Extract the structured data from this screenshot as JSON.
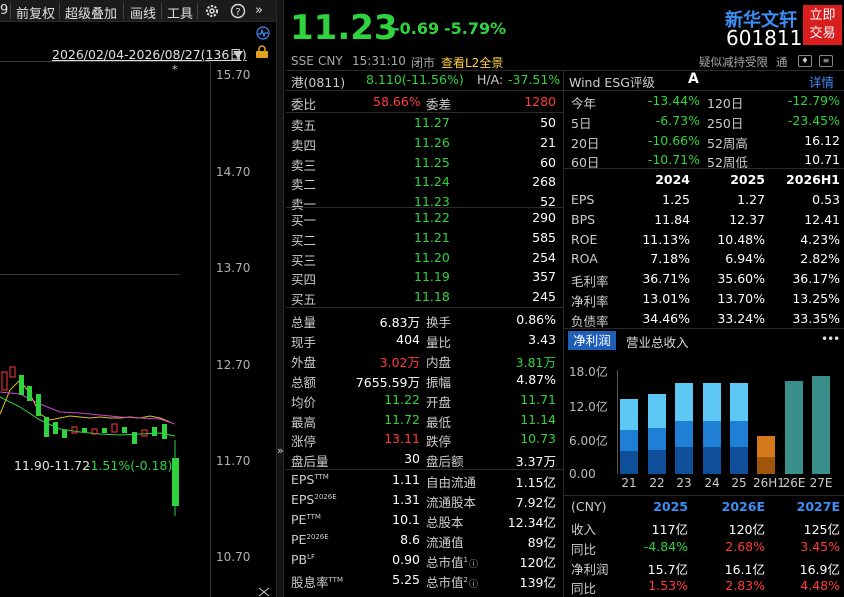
{
  "toolbar": {
    "items": [
      "前复权",
      "超级叠加",
      "画线",
      "工具"
    ],
    "cut_left": "9",
    "more": "»"
  },
  "chart": {
    "date_range": "2026/02/04-2026/08/27(136日)",
    "star": "*",
    "y_ticks": [
      "15.70",
      "14.70",
      "13.70",
      "12.70",
      "11.70",
      "10.70"
    ],
    "range_label": "11.90-11.72",
    "range_change": "-1.51%(-0.18)",
    "collapse_arrow": "»"
  },
  "quote": {
    "price": "11.23",
    "change": "-0.69",
    "change_pct": "-5.79%",
    "exchange": "SSE",
    "currency": "CNY",
    "time": "15:31:10",
    "status": "闭市",
    "l2_link": "查看L2全景",
    "name": "新华文轩",
    "code": "601811",
    "trade_btn_line1": "立即",
    "trade_btn_line2": "交易",
    "note": "疑似减持受限",
    "note2": "通"
  },
  "hk_row": {
    "label": "港(0811)",
    "value": "8.110(-11.56%)",
    "ha_label": "H/A:",
    "ha_value": "-37.51%"
  },
  "orderbook": {
    "wei_bi_label": "委比",
    "wei_bi": "58.66%",
    "wei_cha_label": "委差",
    "wei_cha": "1280",
    "sells": [
      {
        "label": "卖五",
        "price": "11.27",
        "vol": "50"
      },
      {
        "label": "卖四",
        "price": "11.26",
        "vol": "21"
      },
      {
        "label": "卖三",
        "price": "11.25",
        "vol": "60"
      },
      {
        "label": "卖二",
        "price": "11.24",
        "vol": "268"
      },
      {
        "label": "卖一",
        "price": "11.23",
        "vol": "52"
      }
    ],
    "buys": [
      {
        "label": "买一",
        "price": "11.22",
        "vol": "290"
      },
      {
        "label": "买二",
        "price": "11.21",
        "vol": "585"
      },
      {
        "label": "买三",
        "price": "11.20",
        "vol": "254"
      },
      {
        "label": "买四",
        "price": "11.19",
        "vol": "357"
      },
      {
        "label": "买五",
        "price": "11.18",
        "vol": "245"
      }
    ]
  },
  "stats": [
    {
      "l1": "总量",
      "v1": "6.83万",
      "c1": "white",
      "l2": "换手",
      "v2": "0.86%",
      "c2": "white"
    },
    {
      "l1": "现手",
      "v1": "404",
      "c1": "white",
      "l2": "量比",
      "v2": "3.43",
      "c2": "white"
    },
    {
      "l1": "外盘",
      "v1": "3.02万",
      "c1": "red",
      "l2": "内盘",
      "v2": "3.81万",
      "c2": "green"
    },
    {
      "l1": "总额",
      "v1": "7655.59万",
      "c1": "white",
      "l2": "振幅",
      "v2": "4.87%",
      "c2": "white"
    },
    {
      "l1": "均价",
      "v1": "11.22",
      "c1": "green",
      "l2": "开盘",
      "v2": "11.71",
      "c2": "green"
    },
    {
      "l1": "最高",
      "v1": "11.72",
      "c1": "green",
      "l2": "最低",
      "v2": "11.14",
      "c2": "green"
    },
    {
      "l1": "涨停",
      "v1": "13.11",
      "c1": "red",
      "l2": "跌停",
      "v2": "10.73",
      "c2": "green"
    },
    {
      "l1": "盘后量",
      "v1": "30",
      "c1": "white",
      "l2": "盘后额",
      "v2": "3.37万",
      "c2": "white"
    }
  ],
  "valuation": [
    {
      "l1": "EPS",
      "s1": "TTM",
      "v1": "1.11",
      "l2": "自由流通",
      "v2": "1.15亿"
    },
    {
      "l1": "EPS",
      "s1": "2026E",
      "v1": "1.31",
      "l2": "流通股本",
      "v2": "7.92亿"
    },
    {
      "l1": "PE",
      "s1": "TTM",
      "v1": "10.1",
      "l2": "总股本",
      "v2": "12.34亿"
    },
    {
      "l1": "PE",
      "s1": "2026E",
      "v1": "8.6",
      "l2": "流通值",
      "v2": "89亿"
    },
    {
      "l1": "PB",
      "s1": "LF",
      "v1": "0.90",
      "l2": "总市值",
      "s2": "1",
      "v2": "120亿"
    },
    {
      "l1": "股息率",
      "s1": "TTM",
      "v1": "5.25",
      "l2": "总市值",
      "s2": "2",
      "v2": "139亿"
    }
  ],
  "esg": {
    "label": "Wind ESG评级",
    "rating": "A",
    "detail": "详情"
  },
  "perf": [
    {
      "l1": "今年",
      "v1": "-13.44%",
      "l2": "120日",
      "v2": "-12.79%",
      "c2": "green"
    },
    {
      "l1": "5日",
      "v1": "-6.73%",
      "l2": "250日",
      "v2": "-23.45%",
      "c2": "green"
    },
    {
      "l1": "20日",
      "v1": "-10.66%",
      "l2": "52周高",
      "v2": "16.12",
      "c2": "white"
    },
    {
      "l1": "60日",
      "v1": "-10.71%",
      "l2": "52周低",
      "v2": "10.71",
      "c2": "white"
    }
  ],
  "fin": {
    "headers": [
      "2024",
      "2025",
      "2026H1"
    ],
    "rows": [
      {
        "label": "EPS",
        "vals": [
          "1.25",
          "1.27",
          "0.53"
        ]
      },
      {
        "label": "BPS",
        "vals": [
          "11.84",
          "12.37",
          "12.41"
        ]
      },
      {
        "label": "ROE",
        "vals": [
          "11.13%",
          "10.48%",
          "4.23%"
        ]
      },
      {
        "label": "ROA",
        "vals": [
          "7.18%",
          "6.94%",
          "2.82%"
        ]
      },
      {
        "label": "毛利率",
        "vals": [
          "36.71%",
          "35.60%",
          "36.17%"
        ]
      },
      {
        "label": "净利率",
        "vals": [
          "13.01%",
          "13.70%",
          "13.25%"
        ]
      },
      {
        "label": "负债率",
        "vals": [
          "34.46%",
          "33.24%",
          "33.35%"
        ]
      }
    ]
  },
  "profit_tabs": {
    "tab1": "净利润",
    "tab2": "营业总收入",
    "more": "•••"
  },
  "chart_data": {
    "type": "bar",
    "categories": [
      "21",
      "22",
      "23",
      "24",
      "25",
      "26H1",
      "26E",
      "27E"
    ],
    "y_ticks": [
      "18.0亿",
      "12.0亿",
      "6.00亿",
      "0.00"
    ],
    "ylim": [
      0,
      18
    ],
    "values": [
      13.0,
      13.8,
      15.8,
      15.7,
      15.7,
      6.5,
      16.1,
      16.9
    ]
  },
  "forecast": {
    "unit": "(CNY)",
    "headers": [
      "2025",
      "2026E",
      "2027E"
    ],
    "rows": [
      {
        "label": "收入",
        "vals": [
          "117亿",
          "120亿",
          "125亿"
        ],
        "colors": [
          "white",
          "white",
          "white"
        ]
      },
      {
        "label": "同比",
        "vals": [
          "-4.84%",
          "2.68%",
          "3.45%"
        ],
        "colors": [
          "green",
          "red",
          "red"
        ]
      },
      {
        "label": "净利润",
        "vals": [
          "15.7亿",
          "16.1亿",
          "16.9亿"
        ],
        "colors": [
          "white",
          "white",
          "white"
        ]
      },
      {
        "label": "同比",
        "vals": [
          "1.53%",
          "2.83%",
          "4.48%"
        ],
        "colors": [
          "red",
          "red",
          "red"
        ]
      }
    ]
  },
  "colors": {
    "up": "#ff3b3b",
    "down": "#2fd33f",
    "accent": "#3d8ef5",
    "bar_light": "#5ec8f5",
    "bar_mid": "#1f7fd4",
    "bar_dark": "#0f4f9a",
    "bar_h1": "#d47a1a",
    "bar_est": "#3a8f8a"
  }
}
